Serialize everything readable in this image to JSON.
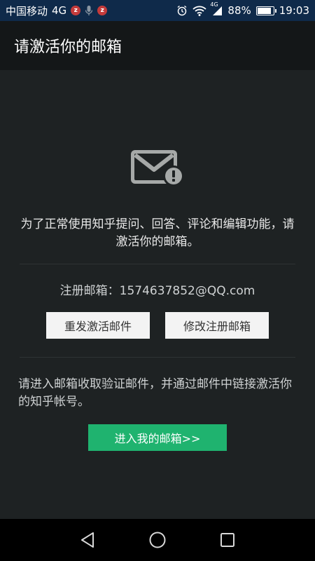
{
  "status_bar": {
    "carrier": "中国移动",
    "network": "4G",
    "signal_label": "4G",
    "battery_percent": 88,
    "battery_text": "88%",
    "time": "19:03",
    "icons": [
      "notification-icon",
      "microphone-icon",
      "notification-icon",
      "alarm-icon",
      "wifi-icon",
      "signal-icon",
      "battery-icon"
    ]
  },
  "header": {
    "title": "请激活你的邮箱"
  },
  "main": {
    "icon": "mail-alert-icon",
    "intro_text": "为了正常使用知乎提问、回答、评论和编辑功能，请激活你的邮箱。",
    "email_label": "注册邮箱：",
    "email_value": "1574637852@QQ.com",
    "resend_button": "重发激活邮件",
    "modify_button": "修改注册邮箱",
    "guide_text": "请进入邮箱收取验证邮件，并通过邮件中链接激活你的知乎帐号。",
    "goto_button": "进入我的邮箱>>"
  },
  "colors": {
    "accent": "#1fb36f",
    "background": "#1e2223",
    "titlebar": "#141718",
    "statusbar": "#0f2a4a"
  },
  "navbar": {
    "items": [
      "back-icon",
      "home-icon",
      "recents-icon"
    ]
  }
}
